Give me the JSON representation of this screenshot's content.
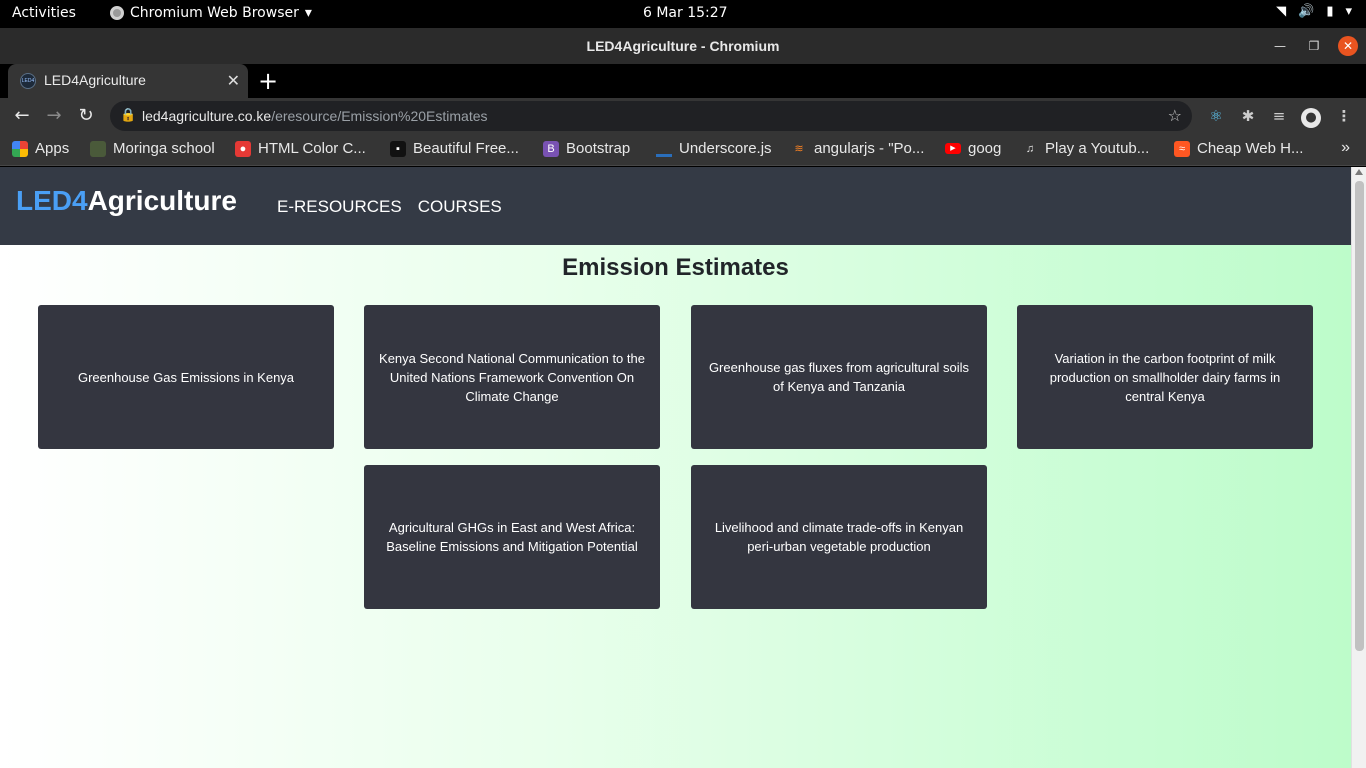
{
  "os": {
    "activities": "Activities",
    "app_menu": "Chromium Web Browser",
    "clock": "6 Mar  15:27"
  },
  "window": {
    "title": "LED4Agriculture - Chromium"
  },
  "tabs": [
    {
      "label": "LED4Agriculture",
      "favicon_text": "LED4"
    }
  ],
  "address_bar": {
    "host": "led4agriculture.co.ke",
    "path": "/eresource/Emission%20Estimates"
  },
  "bookmarks": [
    {
      "label": "Apps",
      "icon": "apps-grid-icon",
      "color": "#e0e0e0"
    },
    {
      "label": "Moringa school",
      "icon": "moringa-icon",
      "color": "#4a5a3a"
    },
    {
      "label": "HTML Color C...",
      "icon": "html-color-icon",
      "color": "#e53935"
    },
    {
      "label": "Beautiful Free...",
      "icon": "unsplash-icon",
      "color": "#111111"
    },
    {
      "label": "Bootstrap",
      "icon": "bootstrap-icon",
      "color": "#7952b3"
    },
    {
      "label": "Underscore.js",
      "icon": "underscore-icon",
      "color": "#2a6ebb"
    },
    {
      "label": "angularjs - \"Po...",
      "icon": "stackoverflow-icon",
      "color": "#f48024"
    },
    {
      "label": "goog",
      "icon": "youtube-icon",
      "color": "#ff0000"
    },
    {
      "label": "Play a Youtub...",
      "icon": "music-note-icon",
      "color": "#353535"
    },
    {
      "label": "Cheap Web H...",
      "icon": "hosting-icon",
      "color": "#ff5722"
    }
  ],
  "site": {
    "brand_part1": "LED4",
    "brand_part2": "Agriculture",
    "nav": [
      "E-RESOURCES",
      "COURSES"
    ],
    "page_title": "Emission Estimates",
    "colors": {
      "brand_blue": "#4a9ff5",
      "navbar": "#343a45",
      "card": "#343640"
    },
    "cards": [
      "Greenhouse Gas Emissions in Kenya",
      "Kenya Second National Communication to the United Nations Framework Convention On Climate Change",
      "Greenhouse gas fluxes from agricultural soils of Kenya and Tanzania",
      "Variation in the carbon footprint of milk production on smallholder dairy farms in central Kenya",
      "Agricultural GHGs in East and West Africa: Baseline Emissions and Mitigation Potential",
      "Livelihood and climate trade-offs in Kenyan peri-urban vegetable production"
    ]
  }
}
